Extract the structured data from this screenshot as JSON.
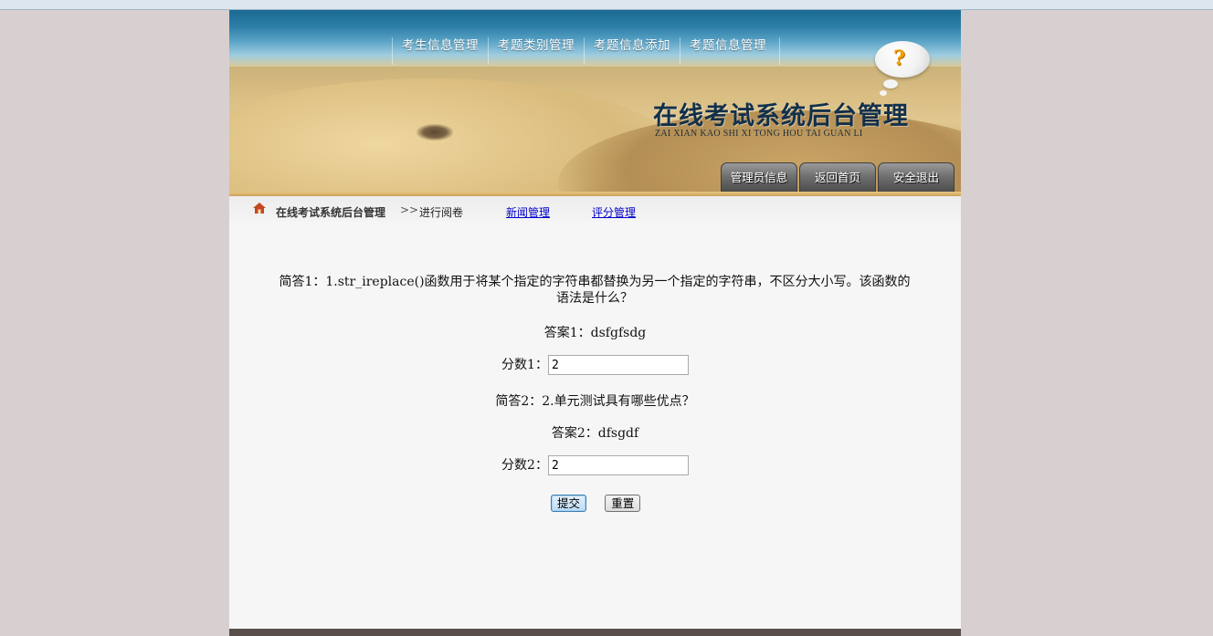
{
  "topnav": {
    "items": [
      "考生信息管理",
      "考题类别管理",
      "考题信息添加",
      "考题信息管理"
    ]
  },
  "header": {
    "title": "在线考试系统后台管理",
    "subtitle": "ZAI XIAN KAO SHI XI TONG HOU TAI GUAN LI",
    "buttons": [
      "管理员信息",
      "返回首页",
      "安全退出"
    ]
  },
  "breadcrumb": {
    "home": "在线考试系统后台管理",
    "separator": ">>",
    "current": "进行阅卷",
    "links": [
      "新闻管理",
      "评分管理"
    ]
  },
  "form": {
    "q1": "简答1：1.str_ireplace()函数用于将某个指定的字符串都替换为另一个指定的字符串，不区分大小写。该函数的语法是什么？",
    "a1": "答案1：dsfgfsdg",
    "score1_label": "分数1：",
    "score1_value": "2",
    "q2": "简答2：2.单元测试具有哪些优点？",
    "a2": "答案2：dfsgdf",
    "score2_label": "分数2：",
    "score2_value": "2",
    "submit_label": "提交",
    "reset_label": "重置"
  },
  "icons": {
    "home": "home-icon",
    "help_bubble": "question-bubble-icon"
  },
  "colors": {
    "page_bg": "#d8d0d0",
    "link": "#0000cc",
    "title": "#12304a"
  }
}
